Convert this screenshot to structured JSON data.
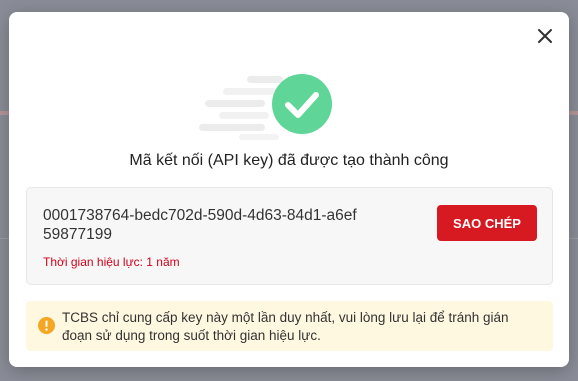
{
  "modal": {
    "title": "Mã kết nối (API key) đã được tạo thành công",
    "api_key": "0001738764-bedc702d-590d-4d63-84d1-a6ef59877199",
    "validity_text": "Thời gian hiệu lực: 1 năm",
    "copy_button_label": "SAO CHÉP",
    "notice_text": "TCBS chỉ cung cấp key này một lần duy nhất, vui lòng lưu lại để tránh gián đoạn sử dụng trong suốt thời gian hiệu lực.",
    "icons": {
      "close": "close-icon",
      "success": "check-circle-icon",
      "info": "info-icon"
    },
    "colors": {
      "success": "#5fd597",
      "accent": "#d71a21",
      "validity": "#d0021b",
      "notice_bg": "#fff8e1",
      "info_icon": "#f5a623"
    }
  }
}
